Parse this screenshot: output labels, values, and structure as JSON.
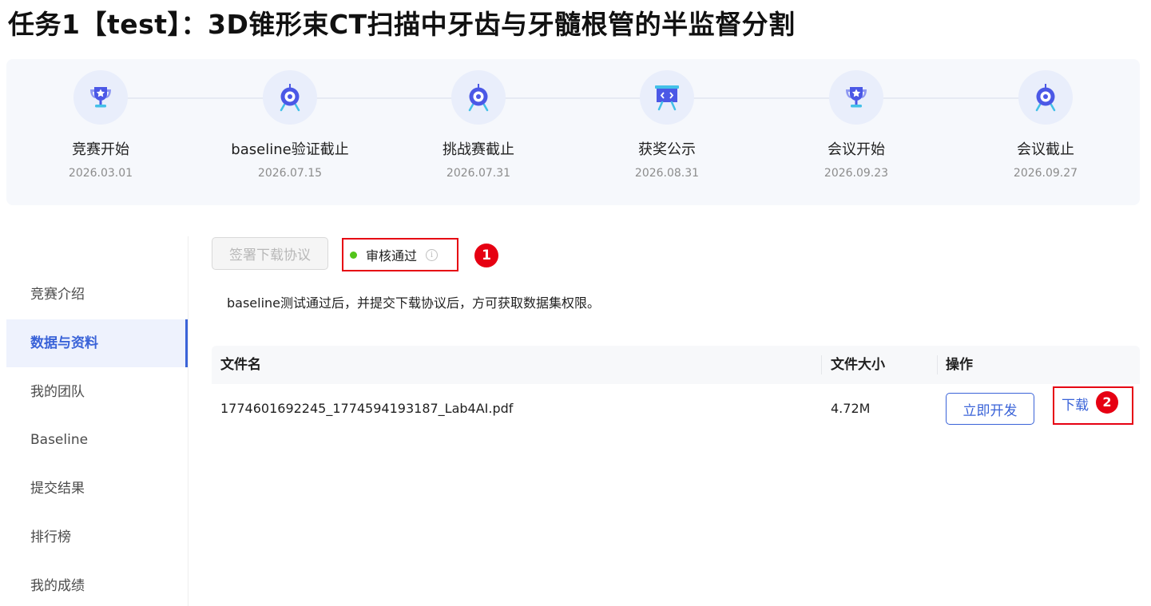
{
  "page": {
    "title": "任务1【test】：3D锥形束CT扫描中牙齿与牙髓根管的半监督分割"
  },
  "timeline": {
    "milestones": [
      {
        "label": "竞赛开始",
        "date": "2026.03.01",
        "icon": "trophy-icon"
      },
      {
        "label": "baseline验证截止",
        "date": "2026.07.15",
        "icon": "target-icon"
      },
      {
        "label": "挑战赛截止",
        "date": "2026.07.31",
        "icon": "target-icon"
      },
      {
        "label": "获奖公示",
        "date": "2026.08.31",
        "icon": "presentation-board-icon"
      },
      {
        "label": "会议开始",
        "date": "2026.09.23",
        "icon": "trophy-icon"
      },
      {
        "label": "会议截止",
        "date": "2026.09.27",
        "icon": "target-icon"
      }
    ],
    "colors": {
      "icon_primary": "#4b58e6",
      "icon_bg": "#e9eefb"
    }
  },
  "sidebar": {
    "items": [
      {
        "label": "竞赛介绍",
        "active": false
      },
      {
        "label": "数据与资料",
        "active": true
      },
      {
        "label": "我的团队",
        "active": false
      },
      {
        "label": "Baseline",
        "active": false
      },
      {
        "label": "提交结果",
        "active": false
      },
      {
        "label": "排行榜",
        "active": false
      },
      {
        "label": "我的成绩",
        "active": false
      }
    ]
  },
  "main": {
    "sign_button_label": "签署下载协议",
    "status_text": "审核通过",
    "status_color": "#52c41a",
    "info_glyph": "i",
    "hint": "baseline测试通过后，并提交下载协议后，方可获取数据集权限。",
    "annotations": {
      "badge1": "1",
      "badge2": "2",
      "highlight_color": "#e60012"
    }
  },
  "table": {
    "headers": {
      "name": "文件名",
      "size": "文件大小",
      "action": "操作"
    },
    "rows": [
      {
        "name": "1774601692245_1774594193187_Lab4AI.pdf",
        "size": "4.72M",
        "dev_label": "立即开发",
        "download_label": "下载"
      }
    ]
  }
}
